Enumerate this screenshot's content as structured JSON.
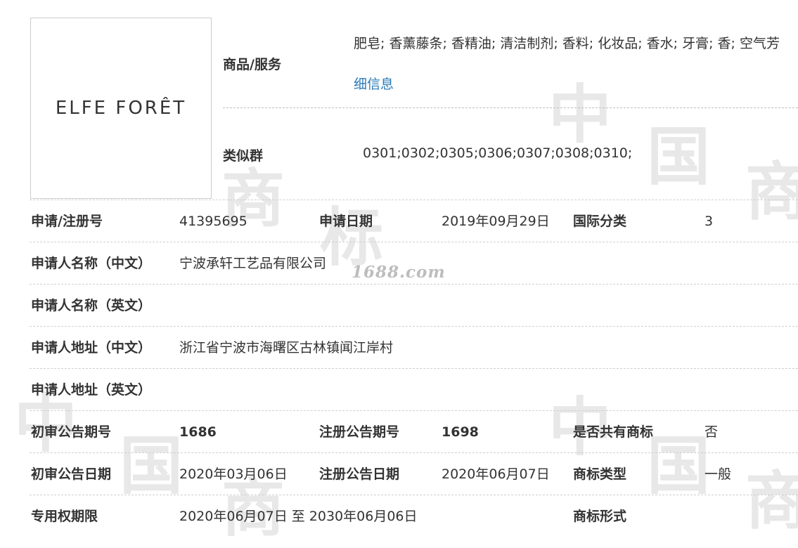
{
  "logo": {
    "text": "ELFE FORÊT"
  },
  "goods": {
    "label": "商品/服务",
    "value": "肥皂; 香薰藤条; 香精油; 清洁制剂; 香料; 化妆品; 香水; 牙膏; 香; 空气芳",
    "detail_link": "细信息"
  },
  "similar_group": {
    "label": "类似群",
    "value": "0301;0302;0305;0306;0307;0308;0310;"
  },
  "watermark": {
    "site": "1688.com",
    "glyph1": "中",
    "glyph2": "国",
    "glyph3": "商",
    "glyph4": "标"
  },
  "fields": {
    "reg_no": {
      "label": "申请/注册号",
      "value": "41395695"
    },
    "apply_date": {
      "label": "申请日期",
      "value": "2019年09月29日"
    },
    "intl_class": {
      "label": "国际分类",
      "value": "3"
    },
    "applicant_cn": {
      "label": "申请人名称（中文）",
      "value": "宁波承轩工艺品有限公司"
    },
    "applicant_en": {
      "label": "申请人名称（英文）",
      "value": ""
    },
    "address_cn": {
      "label": "申请人地址（中文）",
      "value": "浙江省宁波市海曙区古林镇闻江岸村"
    },
    "address_en": {
      "label": "申请人地址（英文）",
      "value": ""
    },
    "prelim_issue": {
      "label": "初审公告期号",
      "value": "1686"
    },
    "reg_issue": {
      "label": "注册公告期号",
      "value": "1698"
    },
    "shared": {
      "label": "是否共有商标",
      "value": "否"
    },
    "prelim_date": {
      "label": "初审公告日期",
      "value": "2020年03月06日"
    },
    "reg_date": {
      "label": "注册公告日期",
      "value": "2020年06月07日"
    },
    "tm_type": {
      "label": "商标类型",
      "value": "一般"
    },
    "exclusive_period": {
      "label": "专用权期限",
      "value": "2020年06月07日 至 2030年06月06日"
    },
    "tm_form": {
      "label": "商标形式",
      "value": ""
    }
  },
  "colors": {
    "link": "#2a7ab8",
    "divider": "#d0d0d0"
  }
}
